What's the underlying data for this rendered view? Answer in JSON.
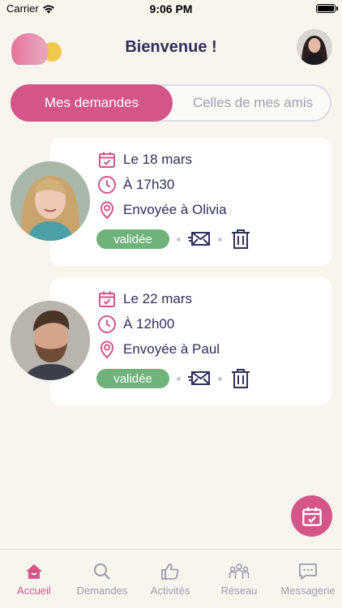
{
  "status_bar": {
    "carrier": "Carrier",
    "time": "9:06 PM"
  },
  "header": {
    "title": "Bienvenue !"
  },
  "segments": {
    "active": "Mes demandes",
    "inactive": "Celles de mes amis"
  },
  "requests": [
    {
      "date": "Le 18 mars",
      "time": "À 17h30",
      "sent_to": "Envoyée à Olivia",
      "status": "validée"
    },
    {
      "date": "Le 22 mars",
      "time": "À 12h00",
      "sent_to": "Envoyée à Paul",
      "status": "validée"
    }
  ],
  "tabs": [
    {
      "label": "Accueil",
      "icon": "home-icon",
      "active": true
    },
    {
      "label": "Demandes",
      "icon": "search-icon",
      "active": false
    },
    {
      "label": "Activités",
      "icon": "thumbs-up-icon",
      "active": false
    },
    {
      "label": "Réseau",
      "icon": "people-icon",
      "active": false
    },
    {
      "label": "Messagerie",
      "icon": "message-icon",
      "active": false
    }
  ],
  "colors": {
    "accent": "#d45588",
    "validated": "#6fb37a",
    "navy": "#2e2f5a",
    "background": "#f8f5ef"
  }
}
